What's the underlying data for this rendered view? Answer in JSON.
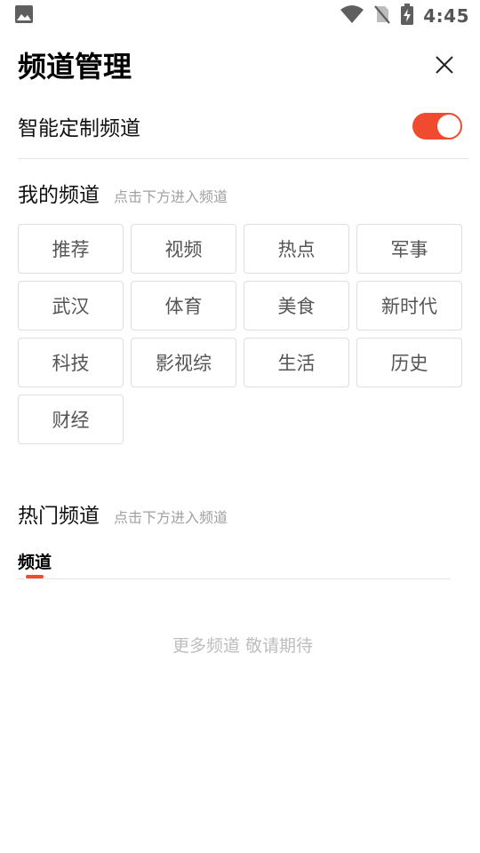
{
  "status_bar": {
    "time": "4:45",
    "icons": [
      "image-icon",
      "wifi-icon",
      "no-sim-icon",
      "battery-charging-icon"
    ]
  },
  "header": {
    "title": "频道管理",
    "close_icon": "close-icon"
  },
  "smart": {
    "label": "智能定制频道",
    "enabled": true,
    "accent_color": "#f04b2e"
  },
  "my_channels": {
    "title": "我的频道",
    "hint": "点击下方进入频道",
    "items": [
      "推荐",
      "视频",
      "热点",
      "军事",
      "武汉",
      "体育",
      "美食",
      "新时代",
      "科技",
      "影视综",
      "生活",
      "历史",
      "财经"
    ]
  },
  "hot_channels": {
    "title": "热门频道",
    "hint": "点击下方进入频道",
    "tabs": [
      "频道"
    ],
    "empty_text": "更多频道 敬请期待"
  }
}
